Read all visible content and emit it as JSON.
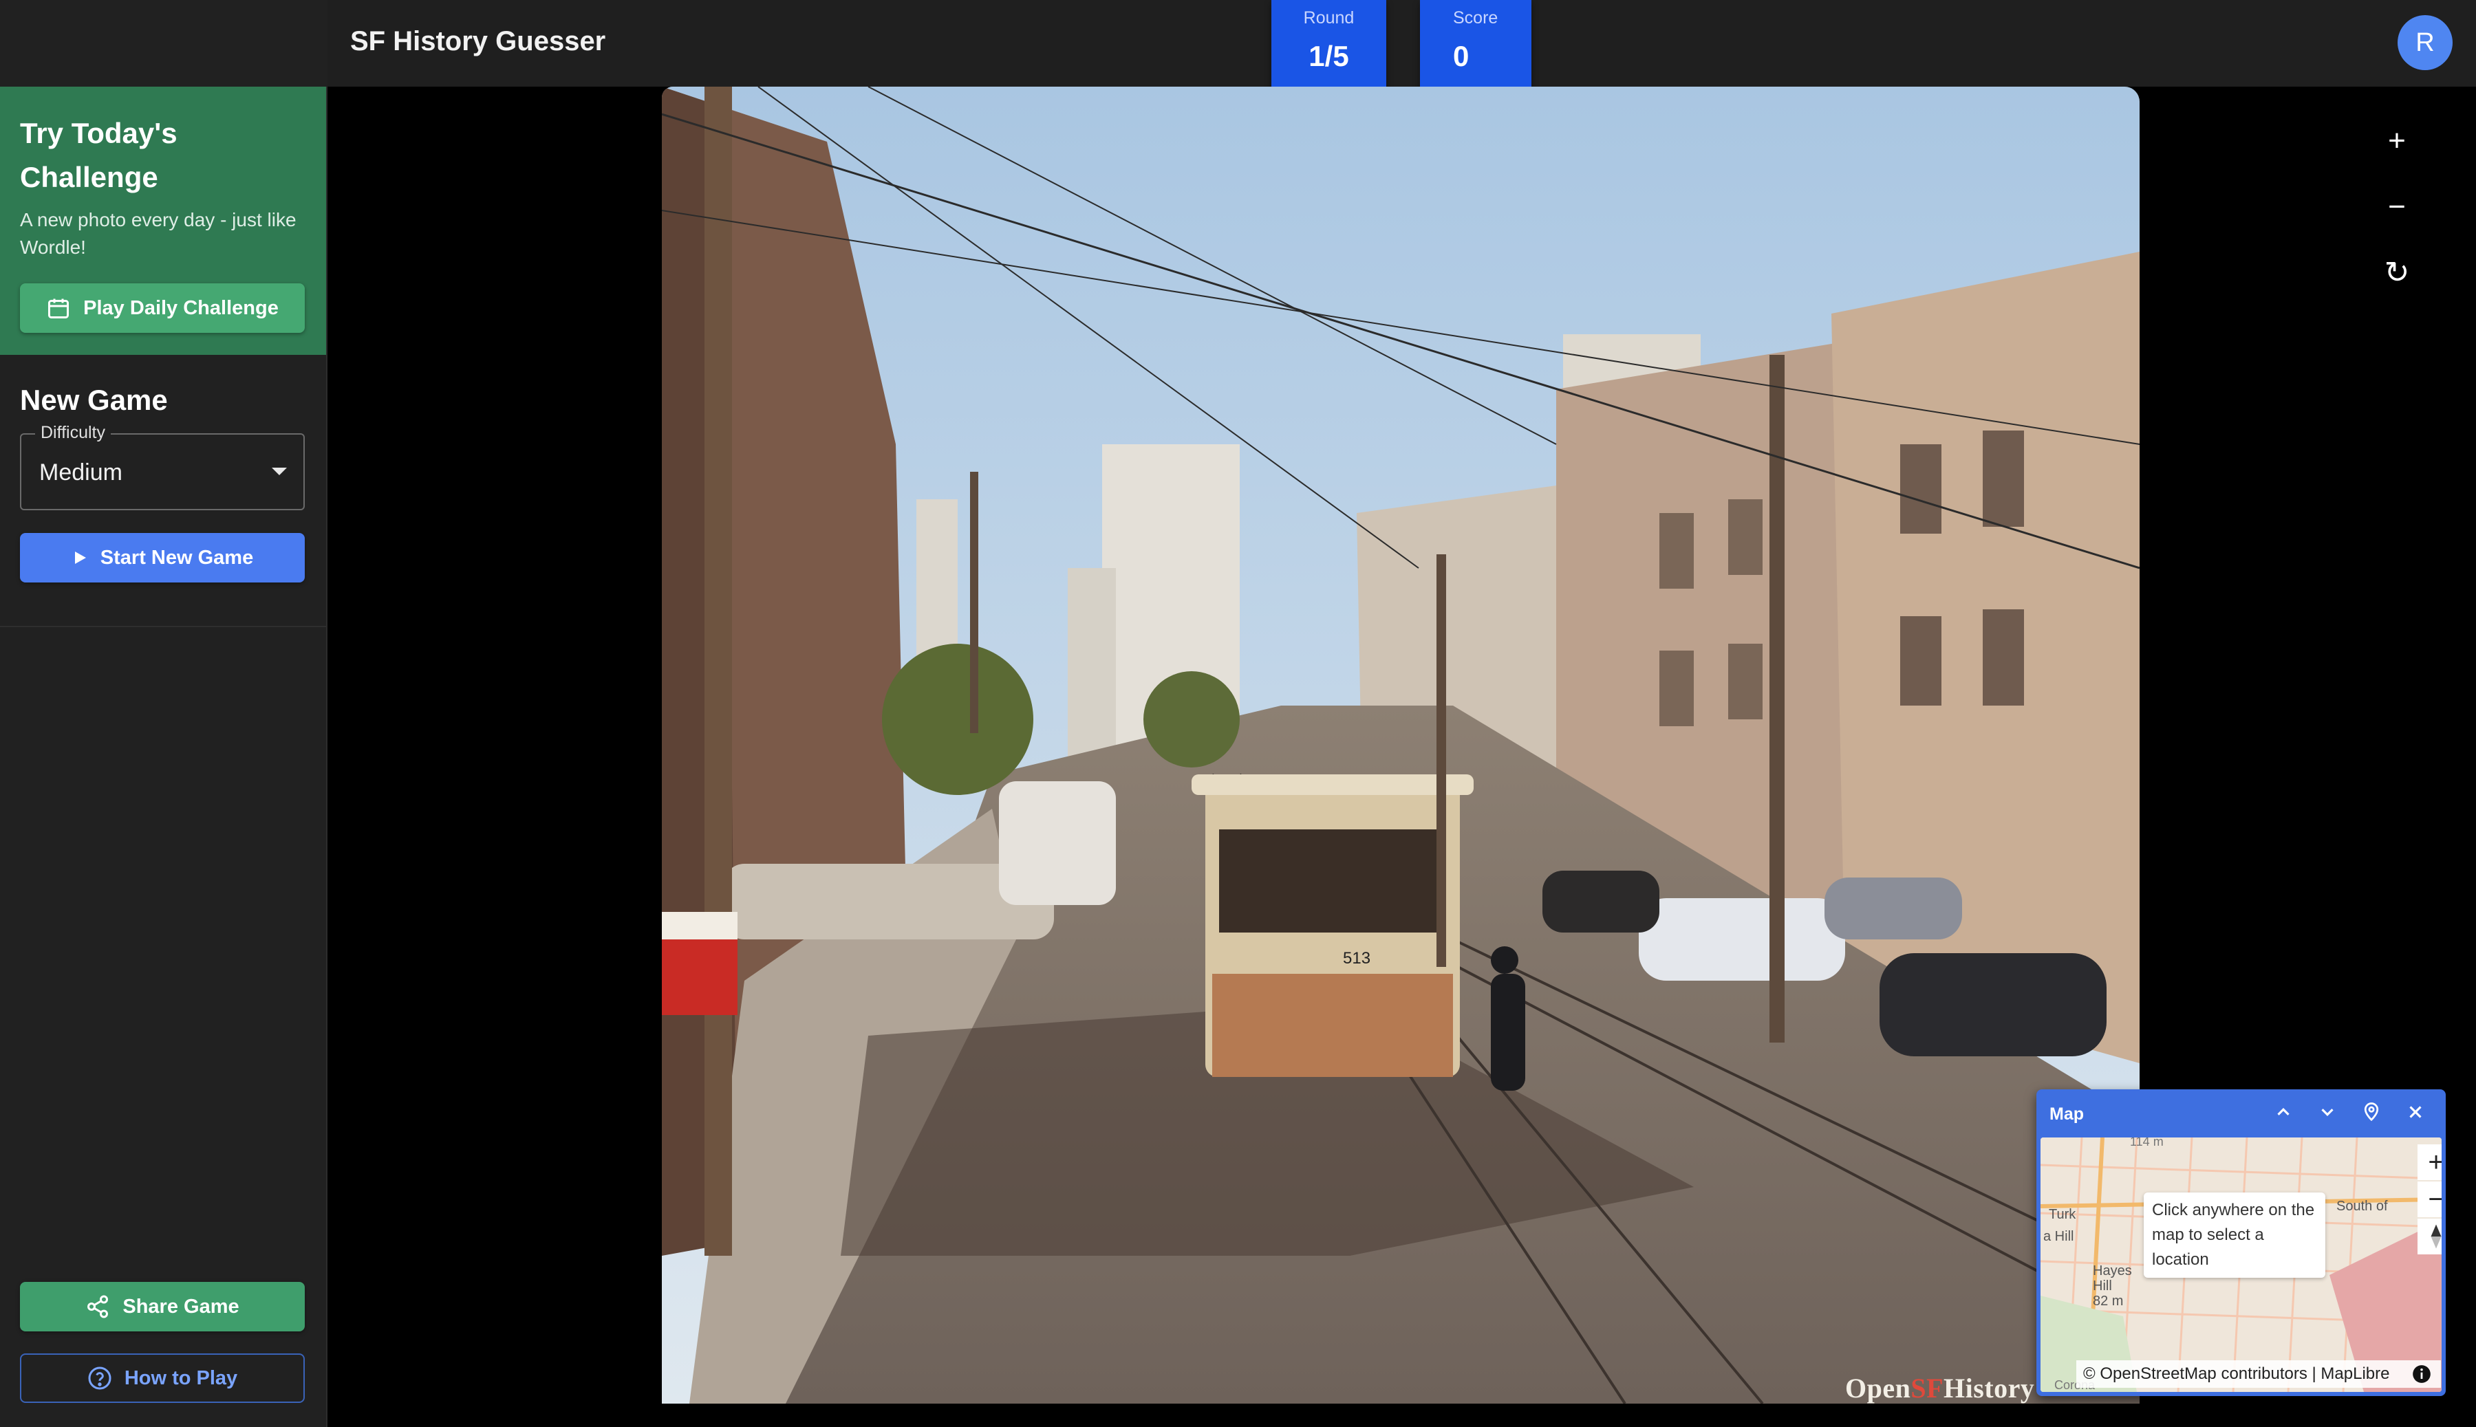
{
  "header": {
    "title": "SF History Guesser",
    "round": {
      "label": "Round",
      "value": "1/5"
    },
    "score": {
      "label": "Score",
      "value": "0"
    },
    "avatar_initial": "R"
  },
  "sidebar": {
    "daily": {
      "title": "Try Today's Challenge",
      "subtitle": "A new photo every day - just like Wordle!",
      "button_label": "Play Daily Challenge"
    },
    "new_game": {
      "title": "New Game",
      "difficulty_label": "Difficulty",
      "difficulty_value": "Medium",
      "start_label": "Start New Game"
    },
    "share_label": "Share Game",
    "how_to_play_label": "How to Play"
  },
  "photo": {
    "credit_prefix": "Open",
    "credit_sf": "SF",
    "credit_suffix": "History",
    "car_number": "513"
  },
  "photo_controls": {
    "zoom_in": "+",
    "zoom_out": "−",
    "reset": "↻"
  },
  "map": {
    "title": "Map",
    "tooltip": "Click anywhere on the map to select a location",
    "attribution": "© OpenStreetMap contributors | MapLibre",
    "labels": [
      "114 m",
      "Turk",
      "a Hill",
      "Hayes",
      "Hill",
      "82 m",
      "South of",
      "Corona"
    ],
    "zoom_in": "+",
    "zoom_out": "−"
  },
  "colors": {
    "accent_blue": "#4a7bf0",
    "daily_green": "#2f7a52",
    "share_green": "#3f9e6c",
    "sidebar_bg": "#212121"
  },
  "icons": [
    "calendar-icon",
    "play-icon",
    "share-icon",
    "help-circle-icon",
    "plus-icon",
    "minus-icon",
    "reset-icon",
    "chevron-up-icon",
    "chevron-down-icon",
    "location-pin-icon",
    "close-icon",
    "compass-icon",
    "info-icon"
  ]
}
